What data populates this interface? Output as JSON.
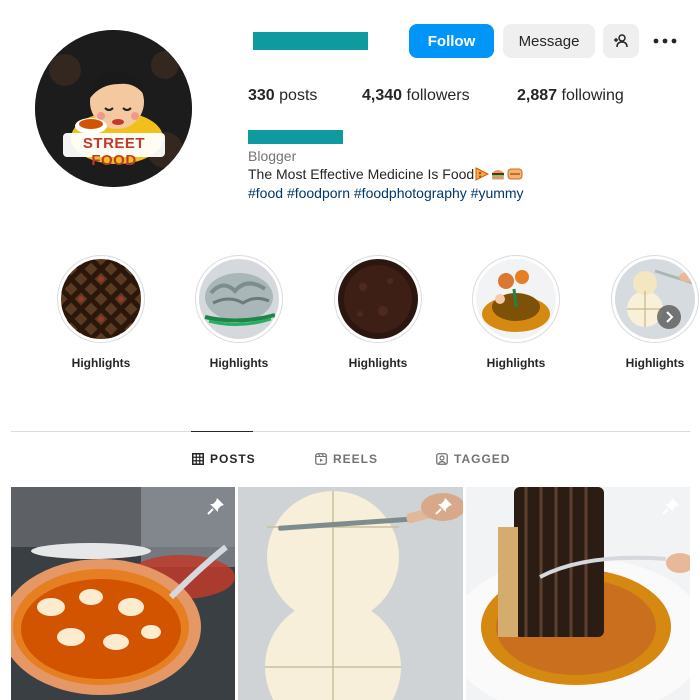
{
  "profile": {
    "avatar_text": "STREET FOOD",
    "follow_label": "Follow",
    "message_label": "Message",
    "stats": {
      "posts_count": "330",
      "posts_label": "posts",
      "followers_count": "4,340",
      "followers_label": "followers",
      "following_count": "2,887",
      "following_label": "following"
    },
    "category": "Blogger",
    "bio": "The Most Effective Medicine Is Food",
    "hashtags": [
      "#food",
      "#foodporn",
      "#foodphotography",
      "#yummy"
    ],
    "redaction_color": "#0f9a9f"
  },
  "highlights": [
    {
      "label": "Highlights"
    },
    {
      "label": "Highlights"
    },
    {
      "label": "Highlights"
    },
    {
      "label": "Highlights"
    },
    {
      "label": "Highlights"
    }
  ],
  "tabs": [
    {
      "label": "POSTS",
      "icon": "grid-icon",
      "active": true
    },
    {
      "label": "REELS",
      "icon": "reels-icon",
      "active": false
    },
    {
      "label": "TAGGED",
      "icon": "tagged-icon",
      "active": false
    }
  ],
  "posts": [
    {
      "subject": "pizza",
      "pinned": true
    },
    {
      "subject": "dough",
      "pinned": true
    },
    {
      "subject": "dessert",
      "pinned": true
    }
  ],
  "colors": {
    "accent": "#0095f6",
    "link": "#00376b",
    "muted": "#737373"
  }
}
